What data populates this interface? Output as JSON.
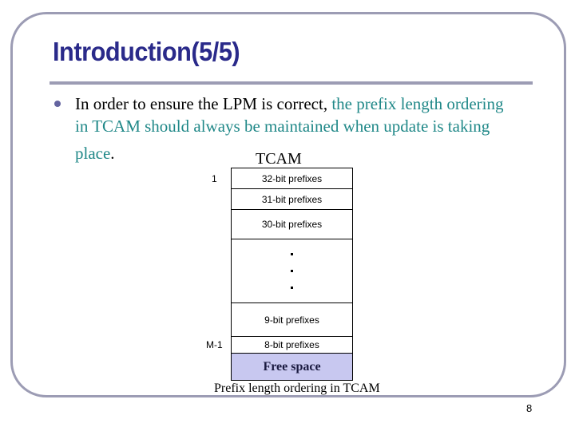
{
  "slide": {
    "title": "Introduction(5/5)",
    "page_number": "8",
    "colors": {
      "title": "#2a2a8a",
      "frame": "#9c9cb4",
      "highlight_text": "#208888",
      "free_space_fill": "#c8c8f0"
    }
  },
  "bullet": {
    "icon": "bullet-dot-icon",
    "plain_text": "In order to ensure the LPM is correct, ",
    "highlight_line1": "the prefix length ordering",
    "highlight_line2": "in TCAM should always be maintained when update is taking",
    "highlight_line3": "place",
    "tail": "."
  },
  "diagram": {
    "label": "TCAM",
    "first_index": "1",
    "last_index": "M-1",
    "rows": [
      {
        "label": "32-bit prefixes"
      },
      {
        "label": "31-bit prefixes"
      },
      {
        "label": "30-bit prefixes"
      },
      {
        "label": "..."
      },
      {
        "label": "9-bit prefixes"
      },
      {
        "label": "8-bit prefixes"
      },
      {
        "label": "Free space"
      }
    ],
    "caption": "Prefix length ordering in TCAM"
  }
}
